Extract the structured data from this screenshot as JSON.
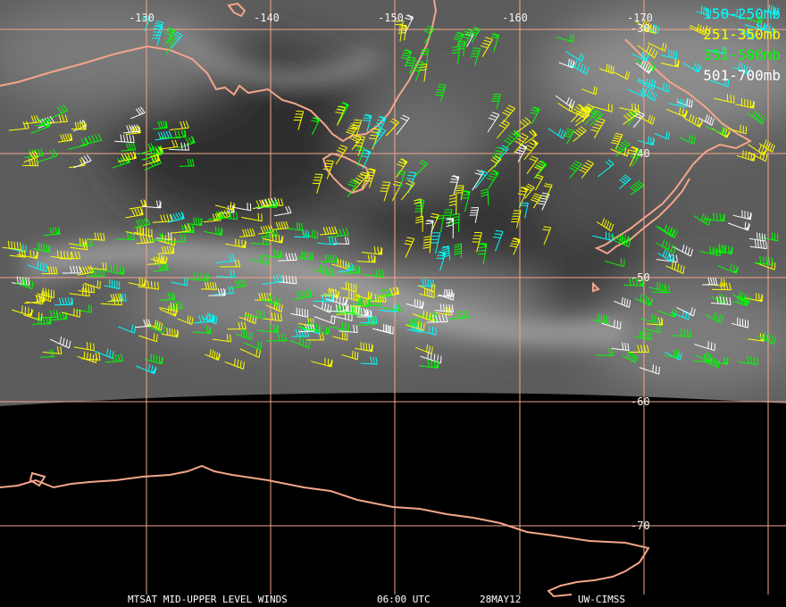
{
  "legend": [
    {
      "label": "150-250mb",
      "color": "#00ffff"
    },
    {
      "label": "251-350mb",
      "color": "#ffff00"
    },
    {
      "label": "351-500mb",
      "color": "#00ff00"
    },
    {
      "label": "501-700mb",
      "color": "#ffffff"
    }
  ],
  "longitude_labels": [
    "-130",
    "-140",
    "-150",
    "-160",
    "-170"
  ],
  "latitude_labels": [
    "-30",
    "-40",
    "-50",
    "-60",
    "-70"
  ],
  "footer": {
    "product": "MTSAT MID-UPPER LEVEL WINDS",
    "time": "06:00 UTC",
    "date": "28MAY12",
    "source": "UW-CIMSS"
  },
  "colors": {
    "coastline": "#f4a58a",
    "gridline": "#f4a58a",
    "space": "#000000",
    "clouds": "#6b6b6b"
  }
}
